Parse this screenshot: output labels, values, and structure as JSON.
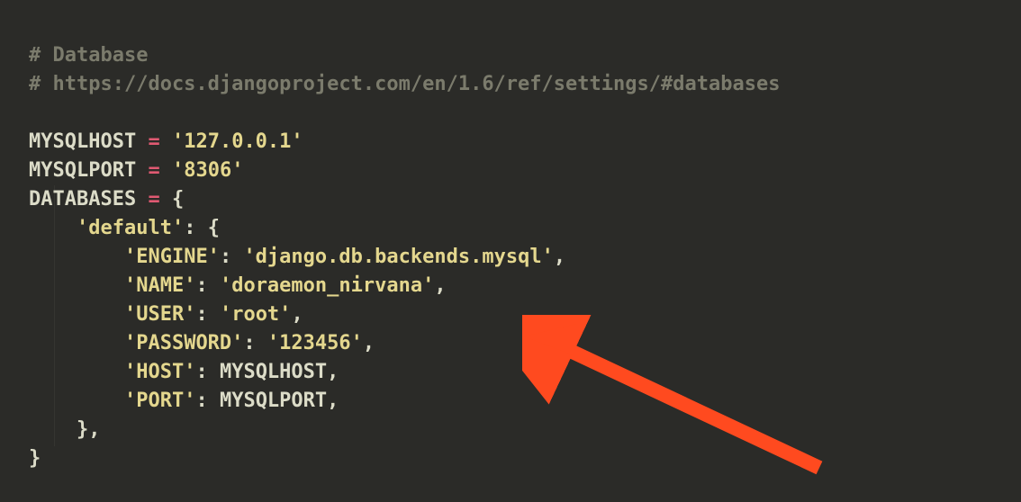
{
  "comment1": "# Database",
  "comment2": "# https://docs.djangoproject.com/en/1.6/ref/settings/#databases",
  "var_host": "MYSQLHOST",
  "var_port": "MYSQLPORT",
  "var_db": "DATABASES",
  "eq": "=",
  "val_host": "'127.0.0.1'",
  "val_port": "'8306'",
  "open_brace": "{",
  "close_brace": "}",
  "k_default": "'default'",
  "k_engine": "'ENGINE'",
  "v_engine": "'django.db.backends.mysql'",
  "k_name": "'NAME'",
  "v_name": "'doraemon_nirvana'",
  "k_user": "'USER'",
  "v_user": "'root'",
  "k_password": "'PASSWORD'",
  "v_password": "'123456'",
  "k_hostk": "'HOST'",
  "k_portk": "'PORT'",
  "colon": ":",
  "comma": ",",
  "arrow_color": "#ff4a1f"
}
